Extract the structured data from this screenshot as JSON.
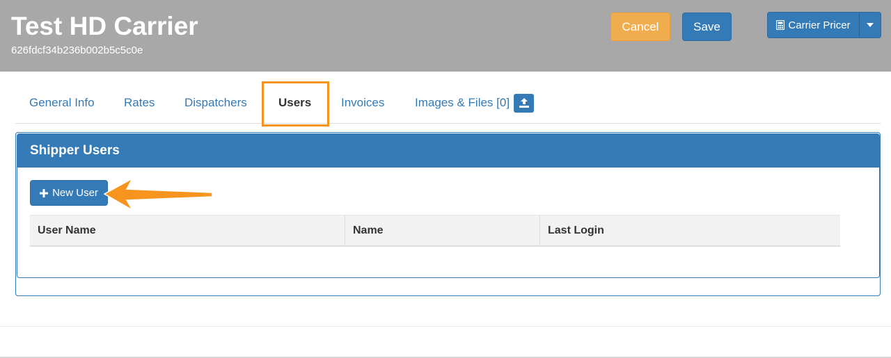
{
  "header": {
    "title": "Test HD Carrier",
    "id": "626fdcf34b236b002b5c5c0e",
    "cancel_label": "Cancel",
    "save_label": "Save",
    "pricer_label": "Carrier Pricer",
    "pricer_icon": "calculator-icon"
  },
  "tabs": [
    {
      "label": "General Info"
    },
    {
      "label": "Rates"
    },
    {
      "label": "Dispatchers"
    },
    {
      "label": "Users",
      "active": true
    },
    {
      "label": "Invoices"
    },
    {
      "label": "Images & Files [0]",
      "icon": "upload-icon"
    }
  ],
  "panel": {
    "title": "Shipper Users",
    "new_user_label": "New User",
    "columns": [
      "User Name",
      "Name",
      "Last Login"
    ]
  },
  "colors": {
    "header_bg": "#a8a8a8",
    "primary": "#337ab7",
    "warning": "#f0ad4e",
    "highlight": "#f7941d"
  }
}
